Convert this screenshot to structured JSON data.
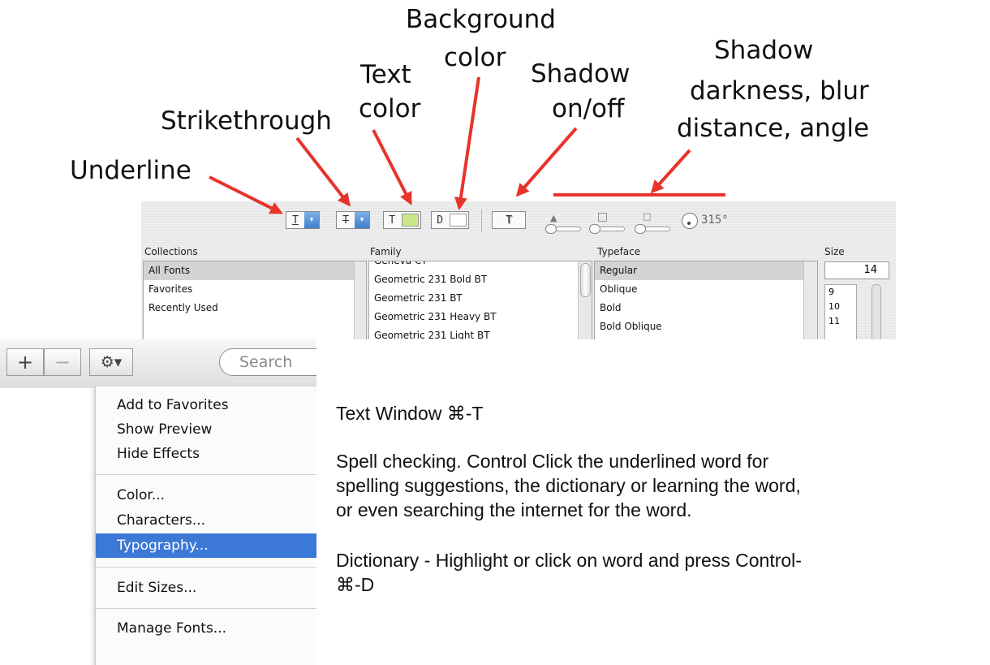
{
  "colors": {
    "arrow": "#e8332b",
    "menu_highlight": "#3c78d5",
    "text_color_swatch": "#c9e88a"
  },
  "callouts": {
    "underline": "Underline",
    "strikethrough": "Strikethrough",
    "text_color_1": "Text",
    "text_color_2": "color",
    "background_color_1": "Background",
    "background_color_2": "color",
    "shadow_onoff_1": "Shadow",
    "shadow_onoff_2": "on/off",
    "shadow_settings_1": "Shadow",
    "shadow_settings_2": "darkness, blur",
    "shadow_settings_3": "distance, angle"
  },
  "font_panel": {
    "toolbar": {
      "underline_glyph": "T",
      "strike_glyph": "T",
      "text_color_glyph": "T",
      "background_glyph": "D",
      "shadow_glyph": "T",
      "dropdown_glyph": "▾",
      "shadow_angle": "315°"
    },
    "headers": {
      "collections": "Collections",
      "family": "Family",
      "typeface": "Typeface",
      "size": "Size"
    },
    "collections": [
      "All Fonts",
      "Favorites",
      "Recently Used"
    ],
    "families": [
      "Geneva CY",
      "Geometric 231 Bold BT",
      "Geometric 231 BT",
      "Geometric 231 Heavy BT",
      "Geometric 231 Light BT"
    ],
    "typefaces": [
      "Regular",
      "Oblique",
      "Bold",
      "Bold Oblique"
    ],
    "size_value": "14",
    "sizes": [
      "9",
      "10",
      "11"
    ]
  },
  "popup": {
    "add_glyph": "+",
    "remove_glyph": "−",
    "gear_glyph": "⚙▾",
    "search_placeholder": "Search",
    "menu": [
      "Add to Favorites",
      "Show Preview",
      "Hide Effects",
      "Color...",
      "Characters...",
      "Typography...",
      "Edit Sizes...",
      "Manage Fonts..."
    ]
  },
  "notes": {
    "line1": "Text Window ⌘-T",
    "line2": "Spell checking. Control Click the underlined word for",
    "line3": "spelling suggestions, the dictionary or learning the word,",
    "line4": "or even searching the internet for the word.",
    "line5": "Dictionary - Highlight or click on word and press Control-",
    "line6": "⌘-D"
  }
}
